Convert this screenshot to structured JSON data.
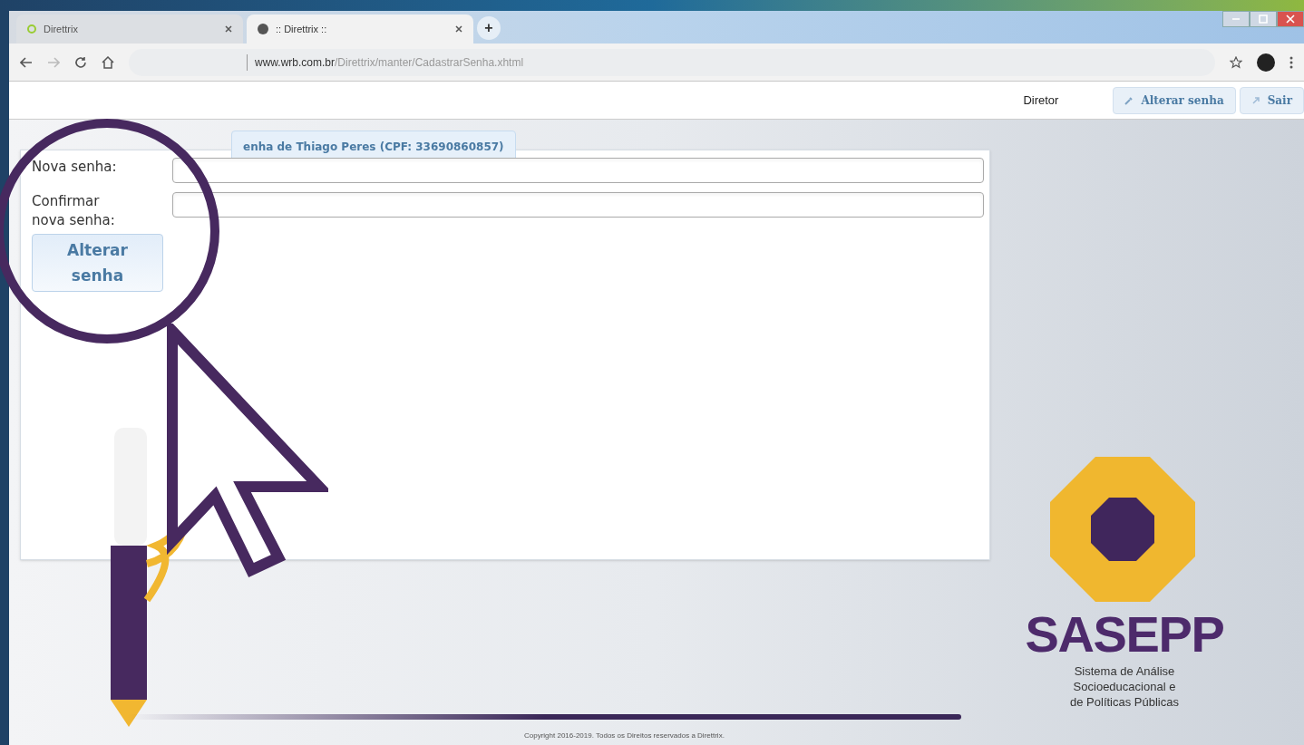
{
  "browser": {
    "tabs": [
      {
        "title": "Direttrix",
        "selected": false
      },
      {
        "title": ":: Direttrix ::",
        "selected": true
      }
    ],
    "new_tab": "+",
    "url_host": "www.wrb.com.br",
    "url_path": "/Direttrix/manter/CadastrarSenha.xhtml"
  },
  "header": {
    "role": "Diretor",
    "actions": [
      {
        "kind": "key",
        "label": "Alterar senha"
      },
      {
        "kind": "exit",
        "label": "Sair"
      }
    ]
  },
  "panel": {
    "title": "enha de Thiago Peres (CPF: 33690860857)",
    "fields": [
      {
        "label": "Nova senha:"
      },
      {
        "label": "Confirmar nova senha:"
      }
    ],
    "button": "Alterar senha"
  },
  "logo": {
    "name": "SASEPP",
    "subtitle_lines": [
      "Sistema de Análise",
      "Socioeducacional e",
      "de Políticas Públicas"
    ]
  },
  "footer": "Copyright 2016-2019. Todos os Direitos reservados a Direttrix."
}
